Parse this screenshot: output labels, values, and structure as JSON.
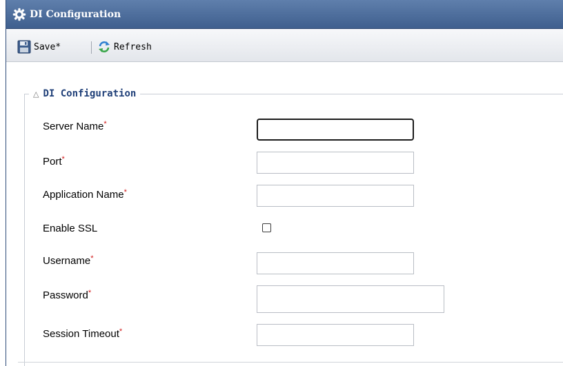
{
  "window": {
    "title": "DI Configuration"
  },
  "toolbar": {
    "save_label": "Save*",
    "refresh_label": "Refresh"
  },
  "section": {
    "title": "DI Configuration"
  },
  "fields": {
    "server_name": {
      "label": "Server Name",
      "value": ""
    },
    "port": {
      "label": "Port",
      "value": ""
    },
    "application_name": {
      "label": "Application Name",
      "value": ""
    },
    "enable_ssl": {
      "label": "Enable SSL",
      "checked": false
    },
    "username": {
      "label": "Username",
      "value": ""
    },
    "password": {
      "label": "Password",
      "value": ""
    },
    "session_timeout": {
      "label": "Session Timeout",
      "value": ""
    }
  },
  "required_marker": "*",
  "icons": {
    "title": "gear-icon",
    "save": "save-disk-icon",
    "refresh": "refresh-icon",
    "collapse": "collapse-triangle-icon"
  },
  "colors": {
    "titlebar": "#4a6a98",
    "section_title": "#1f3f78",
    "required": "#d01818"
  }
}
